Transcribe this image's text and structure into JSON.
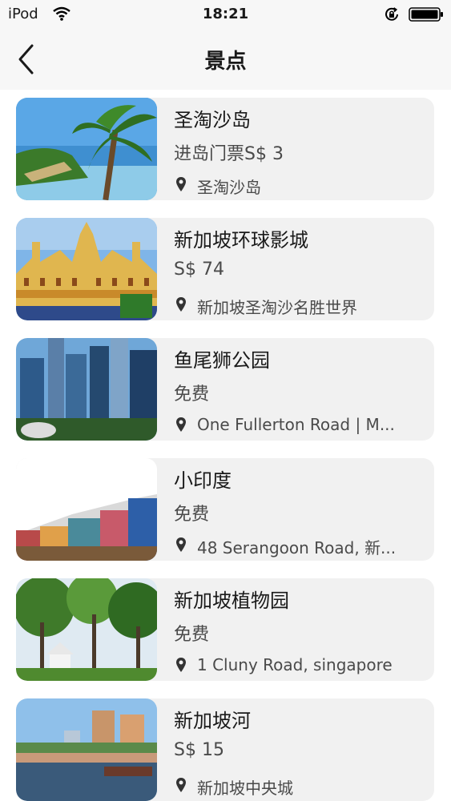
{
  "status_bar": {
    "carrier": "iPod",
    "time": "18:21"
  },
  "nav": {
    "title": "景点"
  },
  "items": [
    {
      "name": "圣淘沙岛",
      "price": "进岛门票S$ 3",
      "address": "圣淘沙岛"
    },
    {
      "name": "新加坡环球影城",
      "price": "S$ 74",
      "address": "新加坡圣淘沙名胜世界"
    },
    {
      "name": "鱼尾狮公园",
      "price": "免费",
      "address": "One Fullerton Road | M..."
    },
    {
      "name": "小印度",
      "price": "免费",
      "address": "48 Serangoon Road, 新..."
    },
    {
      "name": "新加坡植物园",
      "price": "免费",
      "address": "1 Cluny Road, singapore"
    },
    {
      "name": "新加坡河",
      "price": "S$ 15",
      "address": "新加坡中央城"
    }
  ],
  "icons": {
    "back": "chevron-left-icon",
    "location": "location-pin-icon",
    "wifi": "wifi-icon",
    "lock": "rotation-lock-icon",
    "battery": "battery-icon"
  }
}
